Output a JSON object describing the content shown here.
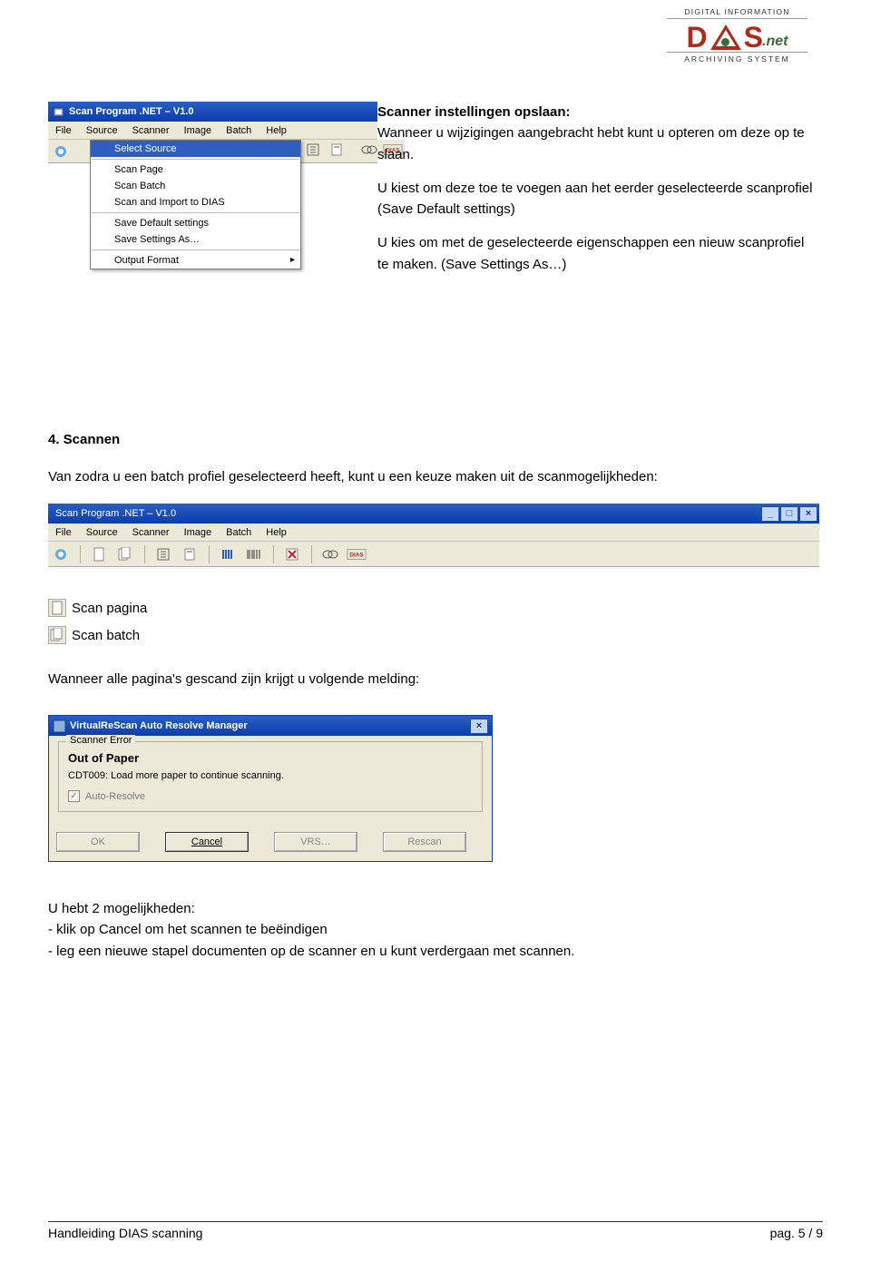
{
  "logo": {
    "top": "DIGITAL  INFORMATION",
    "d": "D",
    "s": "S",
    "net": ".net",
    "bottom": "ARCHIVING  SYSTEM"
  },
  "screenshot1": {
    "title": "Scan Program .NET – V1.0",
    "menus": [
      "File",
      "Source",
      "Scanner",
      "Image",
      "Batch",
      "Help"
    ],
    "dropdown": {
      "highlight": "Select Source",
      "group2": [
        "Scan Page",
        "Scan Batch",
        "Scan and Import to DIAS"
      ],
      "group3": [
        "Save Default settings",
        "Save Settings As…"
      ],
      "group4": "Output Format"
    }
  },
  "side": {
    "h1": "Scanner instellingen opslaan:",
    "p1": "Wanneer u wijzigingen aangebracht hebt kunt u opteren om deze op te slaan.",
    "p2": "U kiest om deze toe te voegen aan het eerder geselecteerde scanprofiel (Save Default settings)",
    "p3": "U kies om met de geselecteerde eigenschappen een nieuw scanprofiel te maken. (Save Settings As…)"
  },
  "sec4": {
    "title": "4. Scannen",
    "intro": "Van zodra u een batch profiel geselecteerd heeft, kunt u een keuze maken uit de scanmogelijkheden:"
  },
  "screenshot2": {
    "title": "Scan Program .NET – V1.0",
    "menus": [
      "File",
      "Source",
      "Scanner",
      "Image",
      "Batch",
      "Help"
    ]
  },
  "iconlines": {
    "scan_page": "Scan pagina",
    "scan_batch": "Scan batch"
  },
  "after_icons": "Wanneer alle pagina's gescand zijn krijgt u volgende melding:",
  "dialog": {
    "title": "VirtualReScan Auto Resolve Manager",
    "legend": "Scanner Error",
    "out": "Out of Paper",
    "msg": "CDT009: Load more paper to continue scanning.",
    "chk": "Auto-Resolve",
    "ok": "OK",
    "cancel": "Cancel",
    "vrs": "VRS…",
    "rescan": "Rescan"
  },
  "after_dialog": {
    "l1": "U hebt 2 mogelijkheden:",
    "l2": "- klik op Cancel om het scannen te beëindigen",
    "l3": "- leg een nieuwe stapel documenten op de scanner en u kunt verdergaan met scannen."
  },
  "footer": {
    "left": "Handleiding DIAS scanning",
    "right": "pag. 5 / 9"
  }
}
